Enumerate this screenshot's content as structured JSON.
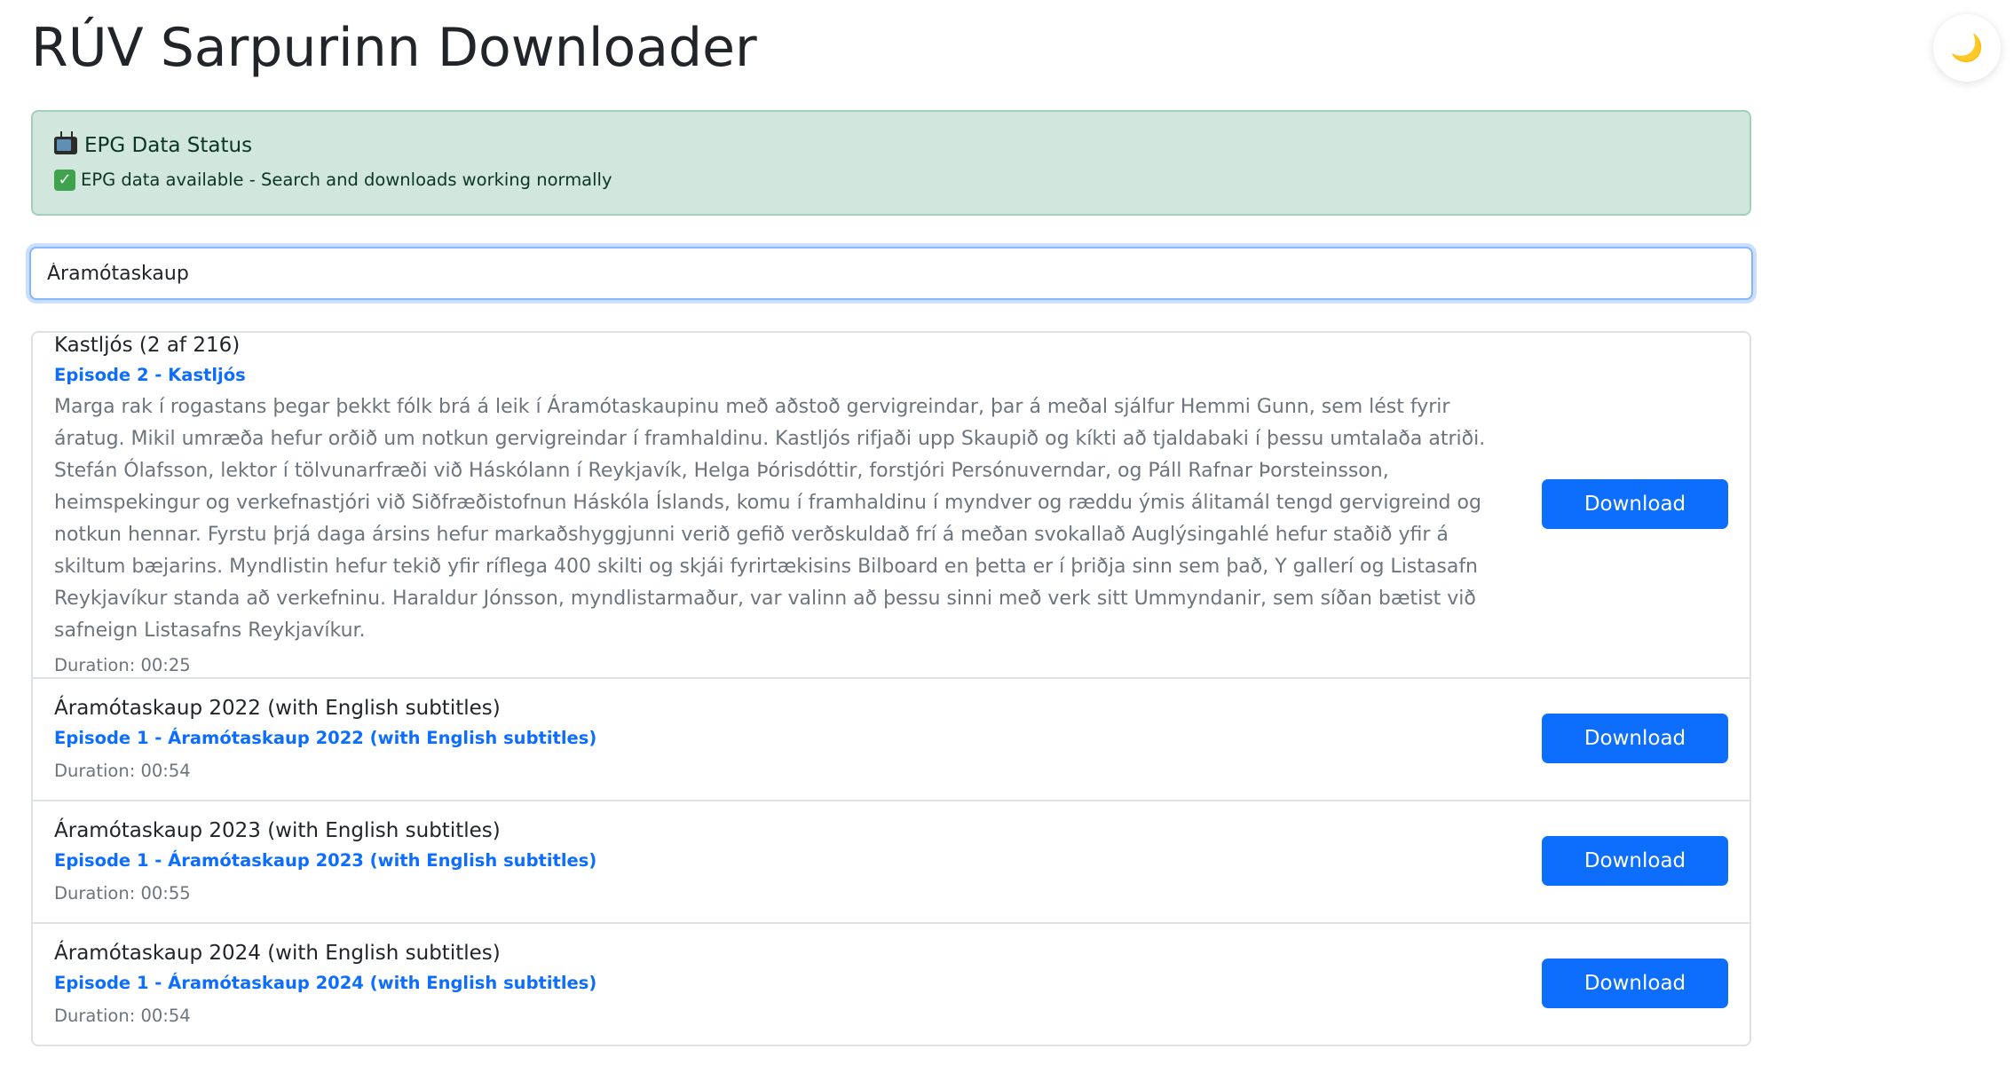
{
  "header": {
    "title": "RÚV Sarpurinn Downloader",
    "theme_toggle_icon": "moon-icon",
    "theme_toggle_glyph": "🌙"
  },
  "status": {
    "icon": "tv-icon",
    "heading": "EPG Data Status",
    "check_icon": "check-icon",
    "check_glyph": "✓",
    "message": "EPG data available - Search and downloads working normally",
    "colors": {
      "background": "#d1e7dd",
      "border": "#a3cfbb",
      "text": "#0a3622"
    }
  },
  "search": {
    "value": "Áramótaskaup"
  },
  "results": [
    {
      "title": "Kastljós (2 af 216)",
      "episode": "Episode 2 - Kastljós",
      "description": "Marga rak í rogastans þegar þekkt fólk brá á leik í Áramótaskaupinu með aðstoð gervigreindar, þar á meðal sjálfur Hemmi Gunn, sem lést fyrir áratug. Mikil umræða hefur orðið um notkun gervigreindar í framhaldinu. Kastljós rifjaði upp Skaupið og kíkti að tjaldabaki í þessu umtalaða atriði. Stefán Ólafsson, lektor í tölvunarfræði við Háskólann í Reykjavík, Helga Þórisdóttir, forstjóri Persónuverndar, og Páll Rafnar Þorsteinsson, heimspekingur og verkefnastjóri við Siðfræðistofnun Háskóla Íslands, komu í framhaldinu í myndver og ræddu ýmis álitamál tengd gervigreind og notkun hennar. Fyrstu þrjá daga ársins hefur markaðshyggjunni verið gefið verðskuldað frí á meðan svokallað Auglýsingahlé hefur staðið yfir á skiltum bæjarins. Myndlistin hefur tekið yfir ríflega 400 skilti og skjái fyrirtækisins Bilboard en þetta er í þriðja sinn sem það, Y gallerí og Listasafn Reykjavíkur standa að verkefninu. Haraldur Jónsson, myndlistarmaður, var valinn að þessu sinni með verk sitt Ummyndanir, sem síðan bætist við safneign Listasafns Reykjavíkur.",
      "duration": "Duration: 00:25",
      "button": "Download"
    },
    {
      "title": "Áramótaskaup 2022 (with English subtitles)",
      "episode": "Episode 1 - Áramótaskaup 2022 (with English subtitles)",
      "description": "",
      "duration": "Duration: 00:54",
      "button": "Download"
    },
    {
      "title": "Áramótaskaup 2023 (with English subtitles)",
      "episode": "Episode 1 - Áramótaskaup 2023 (with English subtitles)",
      "description": "",
      "duration": "Duration: 00:55",
      "button": "Download"
    },
    {
      "title": "Áramótaskaup 2024 (with English subtitles)",
      "episode": "Episode 1 - Áramótaskaup 2024 (with English subtitles)",
      "description": "",
      "duration": "Duration: 00:54",
      "button": "Download"
    }
  ],
  "colors": {
    "accent": "#0d6efd",
    "muted": "#6c757d",
    "border": "#dee2e6"
  }
}
